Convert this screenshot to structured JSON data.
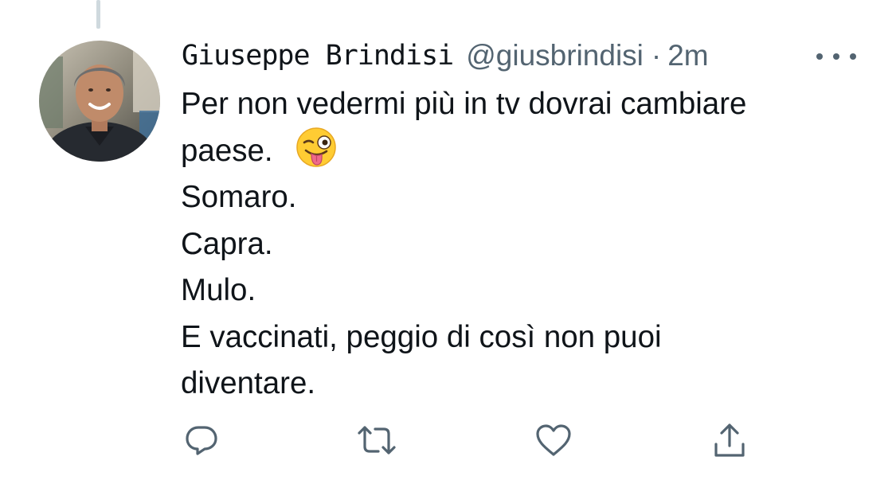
{
  "tweet": {
    "author_name": "Giuseppe Brindisi",
    "handle": "@giusbrindisi",
    "separator": "·",
    "time": "2m",
    "text_lines": [
      "Per non vedermi più in tv dovrai cambiare",
      "paese.",
      "Somaro.",
      "Capra.",
      "Mulo.",
      "E vaccinati, peggio di così non puoi",
      "diventare."
    ],
    "emoji": "winking-face-with-tongue"
  },
  "icons": {
    "more": "more-icon",
    "reply": "reply-icon",
    "retweet": "retweet-icon",
    "like": "like-icon",
    "share": "share-icon"
  },
  "colors": {
    "text": "#0f1419",
    "secondary": "#536471",
    "thread_line": "#cfd9de",
    "background": "#ffffff"
  }
}
